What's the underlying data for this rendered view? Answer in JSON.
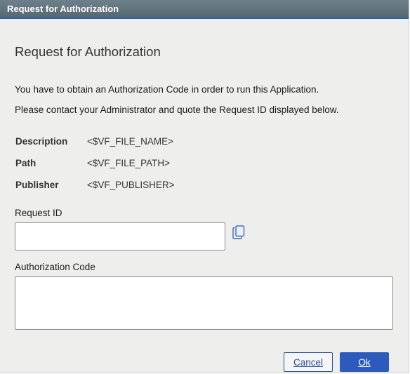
{
  "window": {
    "title": "Request for Authorization"
  },
  "content": {
    "heading": "Request for Authorization",
    "line1": "You have to obtain an Authorization Code in order to run this Application.",
    "line2": "Please contact your Administrator and quote the Request ID displayed below."
  },
  "info": [
    {
      "label": "Description",
      "value": "<$VF_FILE_NAME>"
    },
    {
      "label": "Path",
      "value": "<$VF_FILE_PATH>"
    },
    {
      "label": "Publisher",
      "value": "<$VF_PUBLISHER>"
    }
  ],
  "request_id": {
    "label": "Request ID",
    "value": "",
    "copy_icon": "copy-icon"
  },
  "auth_code": {
    "label": "Authorization Code",
    "value": ""
  },
  "buttons": {
    "cancel": "Cancel",
    "ok": "Ok"
  },
  "colors": {
    "titlebar": "#566872",
    "titlebar_accent": "#2f5fae",
    "primary": "#2c5bbd",
    "background": "#eeeeec"
  }
}
